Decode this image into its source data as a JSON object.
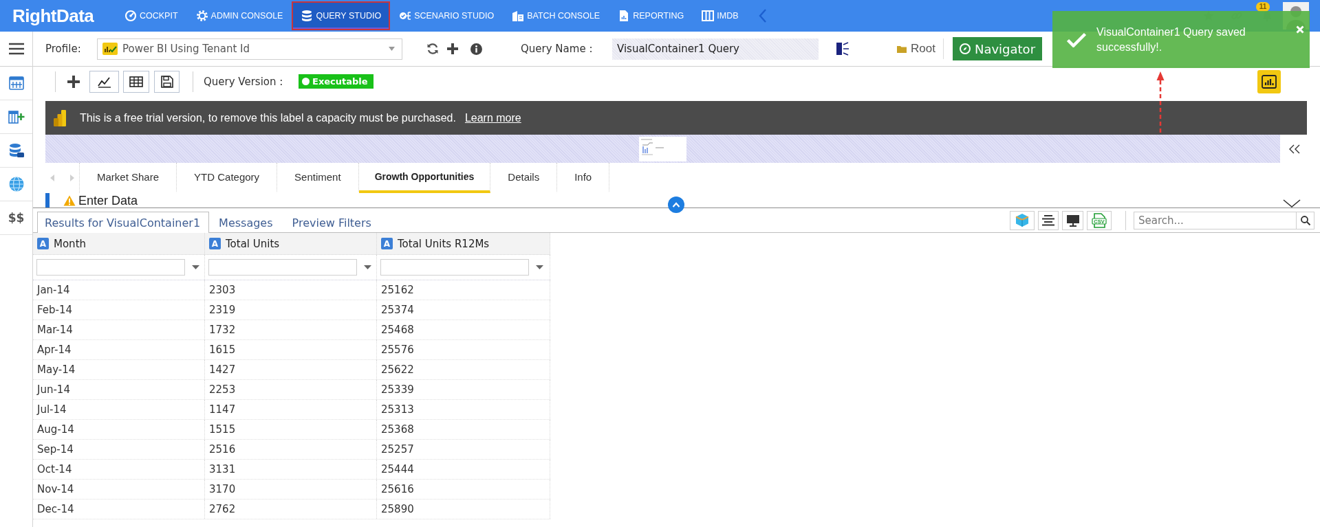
{
  "top_nav": {
    "logo": "RightData",
    "items": [
      {
        "label": "COCKPIT",
        "selected": false
      },
      {
        "label": "ADMIN CONSOLE",
        "selected": false
      },
      {
        "label": "QUERY STUDIO",
        "selected": true
      },
      {
        "label": "SCENARIO STUDIO",
        "selected": false
      },
      {
        "label": "BATCH CONSOLE",
        "selected": false
      },
      {
        "label": "REPORTING",
        "selected": false
      },
      {
        "label": "IMDB",
        "selected": false
      }
    ],
    "notification_count": "11"
  },
  "sidebar": {
    "text_item": "$$"
  },
  "profile_bar": {
    "profile_label": "Profile:",
    "profile_value": "Power BI Using Tenant Id",
    "query_name_label": "Query Name :",
    "query_name_value": "VisualContainer1 Query",
    "folder": "Root",
    "navigator_button": "Navigator"
  },
  "toast": {
    "message": "VisualContainer1 Query saved successfully!."
  },
  "query_toolbar": {
    "version_label": "Query Version :",
    "version_status": "Executable"
  },
  "trial_banner": {
    "text": "This is a free trial version, to remove this label a capacity must be purchased.",
    "link": "Learn more"
  },
  "report_tabs": [
    {
      "label": "Market Share",
      "selected": false
    },
    {
      "label": "YTD Category",
      "selected": false
    },
    {
      "label": "Sentiment",
      "selected": false
    },
    {
      "label": "Growth Opportunities",
      "selected": true
    },
    {
      "label": "Details",
      "selected": false
    },
    {
      "label": "Info",
      "selected": false
    }
  ],
  "report_page": {
    "heading": "Enter Data"
  },
  "results": {
    "tabs": [
      {
        "label": "Results for VisualContainer1",
        "selected": true
      },
      {
        "label": "Messages",
        "selected": false
      },
      {
        "label": "Preview Filters",
        "selected": false
      }
    ],
    "csv_label": "CSV",
    "search": {
      "placeholder": "Search..."
    }
  },
  "table": {
    "columns": [
      {
        "label": "Month",
        "type_badge": "A"
      },
      {
        "label": "Total Units",
        "type_badge": "A"
      },
      {
        "label": "Total Units R12Ms",
        "type_badge": "A"
      }
    ],
    "rows": [
      [
        "Jan-14",
        "2303",
        "25162"
      ],
      [
        "Feb-14",
        "2319",
        "25374"
      ],
      [
        "Mar-14",
        "1732",
        "25468"
      ],
      [
        "Apr-14",
        "1615",
        "25576"
      ],
      [
        "May-14",
        "1427",
        "25622"
      ],
      [
        "Jun-14",
        "2253",
        "25339"
      ],
      [
        "Jul-14",
        "1147",
        "25313"
      ],
      [
        "Aug-14",
        "1515",
        "25368"
      ],
      [
        "Sep-14",
        "2516",
        "25257"
      ],
      [
        "Oct-14",
        "3131",
        "25444"
      ],
      [
        "Nov-14",
        "3170",
        "25616"
      ],
      [
        "Dec-14",
        "2762",
        "25890"
      ]
    ]
  }
}
